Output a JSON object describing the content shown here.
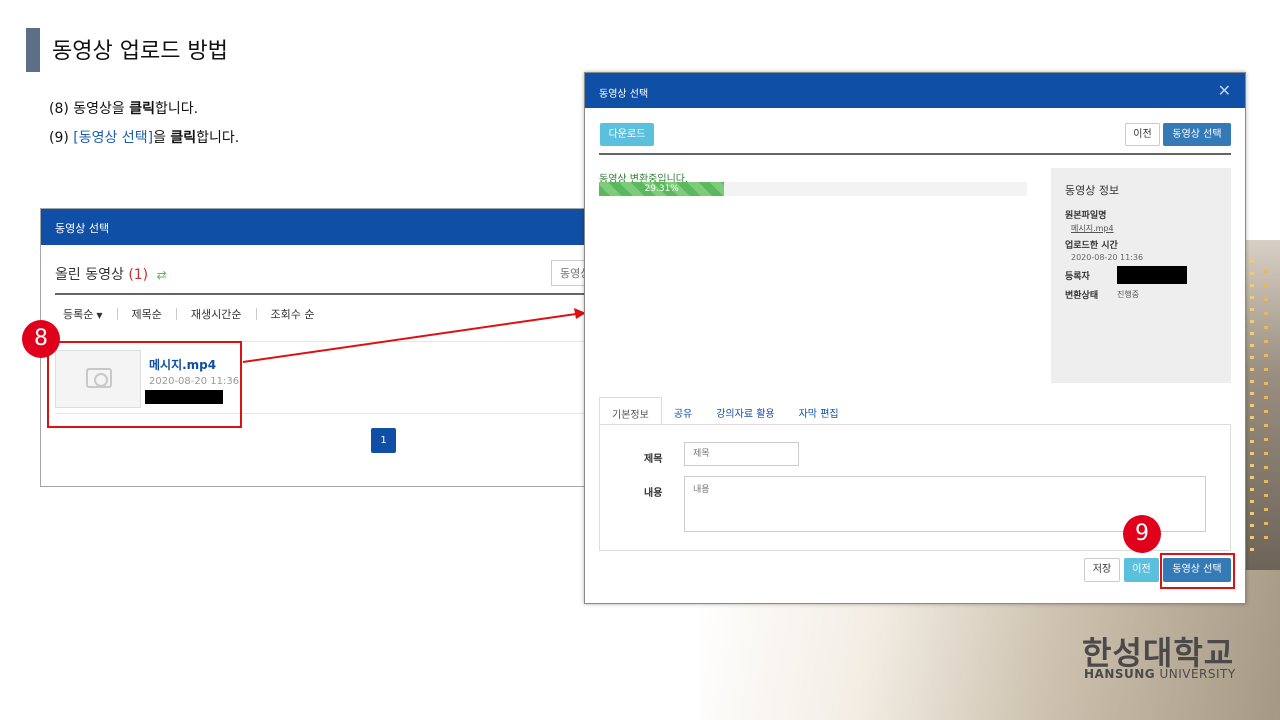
{
  "slide": {
    "title": "동영상 업로드 방법",
    "steps": [
      {
        "prefix": "(8) 동영상을 ",
        "bold": "클릭",
        "suffix": "합니다."
      },
      {
        "prefix": "(9) ",
        "highlight": "[동영상 선택]",
        "mid": "을 ",
        "bold": "클릭",
        "suffix": "합니다."
      }
    ],
    "badges": [
      "8",
      "9"
    ]
  },
  "left_panel": {
    "header": "동영상 선택",
    "uploaded_label": "올린 동영상",
    "uploaded_count": "(1)",
    "search_placeholder": "동영상",
    "sort": [
      "등록순",
      "제목순",
      "재생시간순",
      "조회수 순"
    ],
    "video": {
      "name": "메시지.mp4",
      "date": "2020-08-20 11:36"
    },
    "page": "1"
  },
  "modal": {
    "header": "동영상 선택",
    "download_label": "다운로드",
    "prev_label": "이전",
    "select_label": "동영상 선택",
    "converting_text": "동영상 변환중입니다.",
    "progress_text": "29.31%",
    "progress_fraction": 0.2931,
    "info": {
      "title": "동영상 정보",
      "original_label": "원본파일명",
      "original_value": "메시지.mp4",
      "uploaded_label": "업로드한 시간",
      "uploaded_value": "2020-08-20 11:36",
      "registrant_label": "등록자",
      "status_label": "변환상태",
      "status_value": "진행중"
    },
    "tabs": [
      "기본정보",
      "공유",
      "강의자료 활용",
      "자막 편집"
    ],
    "form": {
      "title_label": "제목",
      "title_placeholder": "제목",
      "content_label": "내용",
      "content_placeholder": "내용"
    },
    "save_label": "저장"
  },
  "logo": {
    "korean": "한성대학교",
    "english_bold": "HANSUNG",
    "english_rest": " UNIVERSITY"
  },
  "colors": {
    "header_blue": "#0f4fa6",
    "highlight_red": "#dd1111",
    "badge_red": "#e0001b",
    "info_blue": "#5bc0de",
    "primary_blue": "#337ab7"
  }
}
